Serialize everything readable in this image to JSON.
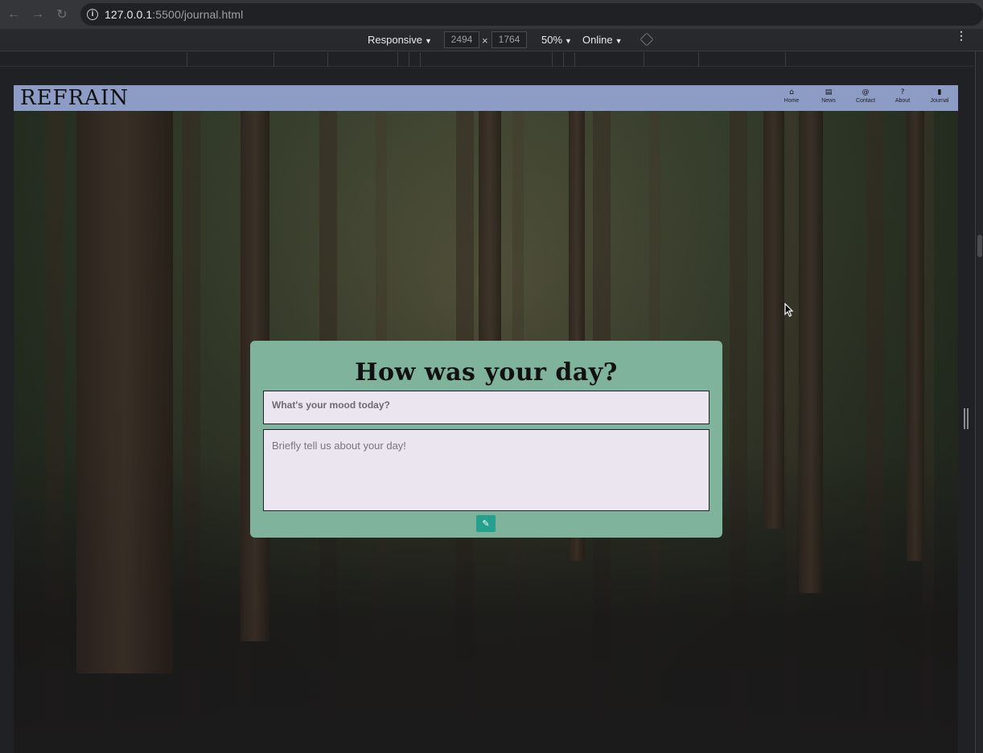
{
  "browser": {
    "url_host": "127.0.0.1",
    "url_rest": ":5500/journal.html"
  },
  "device_toolbar": {
    "mode": "Responsive",
    "width": "2494",
    "height": "1764",
    "zoom": "50%",
    "network": "Online"
  },
  "site": {
    "brand": "REFRAIN",
    "nav": [
      {
        "label": "Home",
        "icon": "home-icon",
        "glyph": "⌂"
      },
      {
        "label": "News",
        "icon": "newspaper-icon",
        "glyph": "▤"
      },
      {
        "label": "Contact",
        "icon": "at-icon",
        "glyph": "@"
      },
      {
        "label": "About",
        "icon": "question-icon",
        "glyph": "?"
      },
      {
        "label": "Journal",
        "icon": "book-icon",
        "glyph": "▮"
      }
    ],
    "nav_color": "#8c9cc4"
  },
  "journal": {
    "title": "How was your day?",
    "mood_placeholder": "What's your mood today?",
    "day_placeholder": "Briefly tell us about your day!",
    "submit_icon": "pencil-icon",
    "card_color": "#80b39c",
    "button_color": "#24a08c"
  }
}
